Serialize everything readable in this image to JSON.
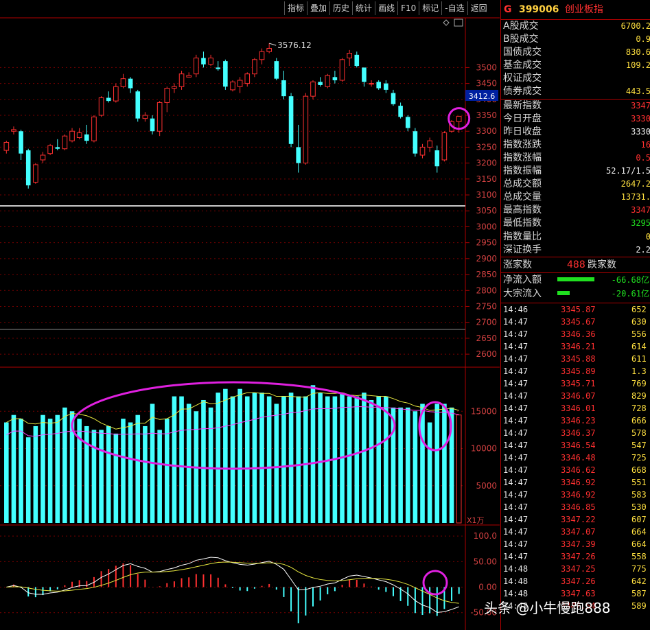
{
  "toolbar": [
    "指标",
    "叠加",
    "历史",
    "统计",
    "画线",
    "F10",
    "标记",
    "-自选",
    "返回"
  ],
  "header": {
    "prefix": "G",
    "code": "399006",
    "name": "创业板指"
  },
  "stats": [
    {
      "label": "A股成交",
      "value": "6700.2",
      "color": "#ffe040"
    },
    {
      "label": "B股成交",
      "value": "0.9",
      "color": "#ffe040"
    },
    {
      "label": "国债成交",
      "value": "830.6",
      "color": "#ffe040"
    },
    {
      "label": "基金成交",
      "value": "109.2",
      "color": "#ffe040"
    },
    {
      "label": "权证成交",
      "value": "",
      "color": "#ffe040"
    },
    {
      "label": "债券成交",
      "value": "443.5",
      "color": "#ffe040"
    },
    {
      "label": "最新指数",
      "value": "3347",
      "color": "#ff3030"
    },
    {
      "label": "今日开盘",
      "value": "3330",
      "color": "#ff3030"
    },
    {
      "label": "昨日收盘",
      "value": "3330",
      "color": "#f0f0f0"
    },
    {
      "label": "指数涨跌",
      "value": "16",
      "color": "#ff3030"
    },
    {
      "label": "指数涨幅",
      "value": "0.5",
      "color": "#ff3030"
    },
    {
      "label": "指数振幅",
      "value": "52.17/1.5",
      "color": "#f0f0f0"
    },
    {
      "label": "总成交额",
      "value": "2647.2",
      "color": "#ffe040"
    },
    {
      "label": "总成交量",
      "value": "13731.",
      "color": "#ffe040"
    },
    {
      "label": "最高指数",
      "value": "3347",
      "color": "#ff3030"
    },
    {
      "label": "最低指数",
      "value": "3295",
      "color": "#20e020"
    },
    {
      "label": "指数量比",
      "value": "0",
      "color": "#ffe040"
    },
    {
      "label": "深证换手",
      "value": "2.2",
      "color": "#f0f0f0"
    }
  ],
  "updown": {
    "up_label": "涨家数",
    "up_value": "488",
    "down_label": "跌家数"
  },
  "flows": [
    {
      "label": "净流入额",
      "value": "-66.68亿",
      "bar": 0.85
    },
    {
      "label": "大宗流入",
      "value": "-20.61亿",
      "bar": 0.28
    }
  ],
  "ticks": [
    [
      "14:46",
      "3345.87",
      "652"
    ],
    [
      "14:47",
      "3345.67",
      "630"
    ],
    [
      "14:47",
      "3346.36",
      "556"
    ],
    [
      "14:47",
      "3346.21",
      "614"
    ],
    [
      "14:47",
      "3345.88",
      "611"
    ],
    [
      "14:47",
      "3345.89",
      "1.3"
    ],
    [
      "14:47",
      "3345.71",
      "769"
    ],
    [
      "14:47",
      "3346.07",
      "829"
    ],
    [
      "14:47",
      "3346.01",
      "728"
    ],
    [
      "14:47",
      "3346.23",
      "666"
    ],
    [
      "14:47",
      "3346.37",
      "578"
    ],
    [
      "14:47",
      "3346.54",
      "547"
    ],
    [
      "14:47",
      "3346.48",
      "725"
    ],
    [
      "14:47",
      "3346.62",
      "668"
    ],
    [
      "14:47",
      "3346.92",
      "551"
    ],
    [
      "14:47",
      "3346.92",
      "583"
    ],
    [
      "14:47",
      "3346.85",
      "530"
    ],
    [
      "14:47",
      "3347.22",
      "607"
    ],
    [
      "14:47",
      "3347.07",
      "664"
    ],
    [
      "14:47",
      "3347.39",
      "664"
    ],
    [
      "14:47",
      "3347.26",
      "558"
    ],
    [
      "14:48",
      "3347.25",
      "775"
    ],
    [
      "14:48",
      "3347.26",
      "642"
    ],
    [
      "14:48",
      "3347.63",
      "587"
    ],
    [
      "14:48",
      "3347.54",
      "589"
    ]
  ],
  "price_axis": {
    "ticks": [
      3500,
      3450,
      3400,
      3350,
      3300,
      3250,
      3200,
      3150,
      3100,
      3050,
      3000,
      2950,
      2900,
      2850,
      2800,
      2750,
      2700,
      2650,
      2600
    ],
    "tick_labels": [
      "3500",
      "3450",
      "3400",
      "3350",
      "3300",
      "3250",
      "3200",
      "3150",
      "3100",
      "3050",
      "3000",
      "2950",
      "2900",
      "2850",
      "2800",
      "2750",
      "2700",
      "2650",
      "2600"
    ],
    "current": "3412.6",
    "high_label": "3576.12"
  },
  "volume_axis": {
    "ticks": [
      15000,
      10000,
      5000
    ],
    "tick_labels": [
      "15000",
      "10000",
      "5000"
    ],
    "unit": "X1万"
  },
  "macd_axis": {
    "ticks": [
      100,
      50,
      0,
      -50
    ],
    "tick_labels": [
      "100.0",
      "50.00",
      "0.00",
      "-50.00"
    ]
  },
  "colors": {
    "up": "#ff3030",
    "down": "#44ffff",
    "ma_yellow": "#e8e840",
    "ma_magenta": "#ff40ff",
    "annot": "#e020e0",
    "grid": "#7a0000"
  },
  "chart_data": {
    "type": "candlestick",
    "ohlc": [
      [
        3240,
        3270,
        3230,
        3265
      ],
      [
        3300,
        3315,
        3290,
        3305
      ],
      [
        3300,
        3305,
        3210,
        3230
      ],
      [
        3240,
        3245,
        3120,
        3130
      ],
      [
        3140,
        3200,
        3135,
        3195
      ],
      [
        3210,
        3235,
        3200,
        3225
      ],
      [
        3230,
        3260,
        3225,
        3255
      ],
      [
        3250,
        3275,
        3240,
        3245
      ],
      [
        3245,
        3290,
        3240,
        3285
      ],
      [
        3270,
        3310,
        3265,
        3300
      ],
      [
        3280,
        3310,
        3275,
        3295
      ],
      [
        3290,
        3320,
        3260,
        3270
      ],
      [
        3270,
        3350,
        3265,
        3345
      ],
      [
        3350,
        3410,
        3345,
        3405
      ],
      [
        3405,
        3425,
        3390,
        3395
      ],
      [
        3395,
        3450,
        3390,
        3440
      ],
      [
        3440,
        3480,
        3435,
        3465
      ],
      [
        3465,
        3470,
        3420,
        3435
      ],
      [
        3425,
        3430,
        3330,
        3340
      ],
      [
        3340,
        3360,
        3330,
        3350
      ],
      [
        3340,
        3350,
        3290,
        3300
      ],
      [
        3300,
        3395,
        3285,
        3390
      ],
      [
        3390,
        3440,
        3360,
        3435
      ],
      [
        3435,
        3450,
        3420,
        3440
      ],
      [
        3440,
        3490,
        3430,
        3480
      ],
      [
        3470,
        3485,
        3470,
        3475
      ],
      [
        3480,
        3540,
        3470,
        3530
      ],
      [
        3530,
        3550,
        3500,
        3510
      ],
      [
        3510,
        3540,
        3505,
        3530
      ],
      [
        3500,
        3520,
        3490,
        3495
      ],
      [
        3520,
        3525,
        3430,
        3440
      ],
      [
        3430,
        3460,
        3425,
        3455
      ],
      [
        3440,
        3470,
        3420,
        3460
      ],
      [
        3450,
        3485,
        3440,
        3480
      ],
      [
        3480,
        3530,
        3470,
        3525
      ],
      [
        3525,
        3560,
        3510,
        3550
      ],
      [
        3550,
        3576,
        3545,
        3560
      ],
      [
        3520,
        3530,
        3460,
        3465
      ],
      [
        3460,
        3490,
        3400,
        3410
      ],
      [
        3410,
        3420,
        3250,
        3260
      ],
      [
        3250,
        3320,
        3170,
        3200
      ],
      [
        3200,
        3420,
        3195,
        3410
      ],
      [
        3410,
        3460,
        3400,
        3455
      ],
      [
        3455,
        3470,
        3440,
        3445
      ],
      [
        3440,
        3480,
        3435,
        3475
      ],
      [
        3470,
        3490,
        3450,
        3460
      ],
      [
        3460,
        3530,
        3455,
        3525
      ],
      [
        3530,
        3555,
        3505,
        3545
      ],
      [
        3540,
        3550,
        3500,
        3505
      ],
      [
        3500,
        3490,
        3440,
        3455
      ],
      [
        3450,
        3460,
        3440,
        3450
      ],
      [
        3455,
        3460,
        3430,
        3435
      ],
      [
        3450,
        3460,
        3420,
        3430
      ],
      [
        3420,
        3430,
        3380,
        3385
      ],
      [
        3380,
        3390,
        3340,
        3345
      ],
      [
        3345,
        3350,
        3300,
        3310
      ],
      [
        3300,
        3310,
        3220,
        3230
      ],
      [
        3225,
        3260,
        3215,
        3250
      ],
      [
        3250,
        3280,
        3235,
        3270
      ],
      [
        3240,
        3255,
        3170,
        3190
      ],
      [
        3210,
        3300,
        3205,
        3295
      ],
      [
        3300,
        3335,
        3295,
        3330
      ],
      [
        3330,
        3347,
        3295,
        3347
      ]
    ],
    "volume": [
      13500,
      14500,
      14000,
      11500,
      13000,
      14500,
      14000,
      14500,
      15500,
      15000,
      14000,
      13000,
      12500,
      12500,
      13000,
      12000,
      14000,
      13500,
      14500,
      13000,
      16000,
      12500,
      14000,
      17000,
      17000,
      16000,
      15000,
      16500,
      15500,
      17500,
      18000,
      17000,
      18000,
      17000,
      17500,
      17500,
      17000,
      16000,
      17000,
      17500,
      17000,
      17000,
      18500,
      17500,
      17000,
      17000,
      17500,
      17000,
      17000,
      17500,
      16500,
      17000,
      17000,
      15500,
      15500,
      15500,
      15000,
      16000,
      13500,
      16000,
      16000,
      15500,
      14500
    ],
    "ylim_price": [
      2570,
      3600
    ],
    "ylim_volume": [
      0,
      20000
    ],
    "ylim_macd": [
      -80,
      115
    ]
  }
}
